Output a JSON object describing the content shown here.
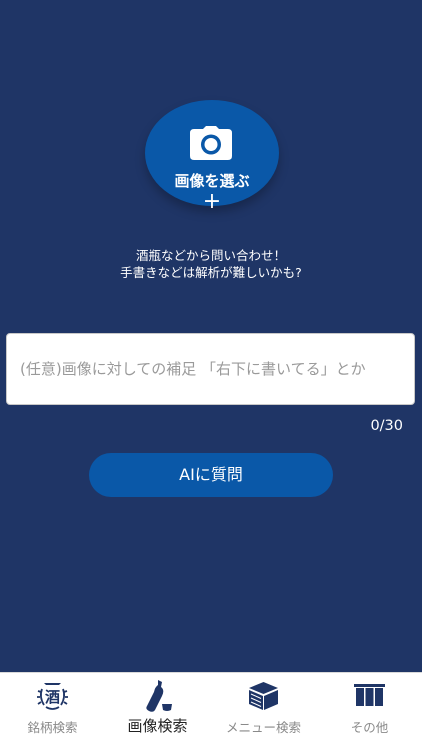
{
  "colors": {
    "background": "#1f3566",
    "accent_blue": "#0a58a8",
    "tab_bar": "#ffffff",
    "tab_label_inactive": "#8a8a8a",
    "tab_label_active": "#222222",
    "icon_dark": "#1f3566"
  },
  "photo": {
    "label": "画像を選ぶ",
    "plus": "+",
    "icon": "camera-icon"
  },
  "hint": {
    "line1": "酒瓶などから問い合わせ！",
    "line2": "手書きなどは解析が難しいかも?"
  },
  "supplement": {
    "placeholder": "(任意)画像に対しての補足 「右下に書いてる」とか",
    "value": ""
  },
  "counter": "0/30",
  "ask_button": {
    "label": "AIに質問"
  },
  "tabs": [
    {
      "label": "銘柄検索",
      "icon": "sake-emblem-icon",
      "active": false
    },
    {
      "label": "画像検索",
      "icon": "sake-bottle-icon",
      "active": true
    },
    {
      "label": "メニュー検索",
      "icon": "menu-box-icon",
      "active": false
    },
    {
      "label": "その他",
      "icon": "noren-curtain-icon",
      "active": false
    }
  ],
  "emblem_text": "酒"
}
